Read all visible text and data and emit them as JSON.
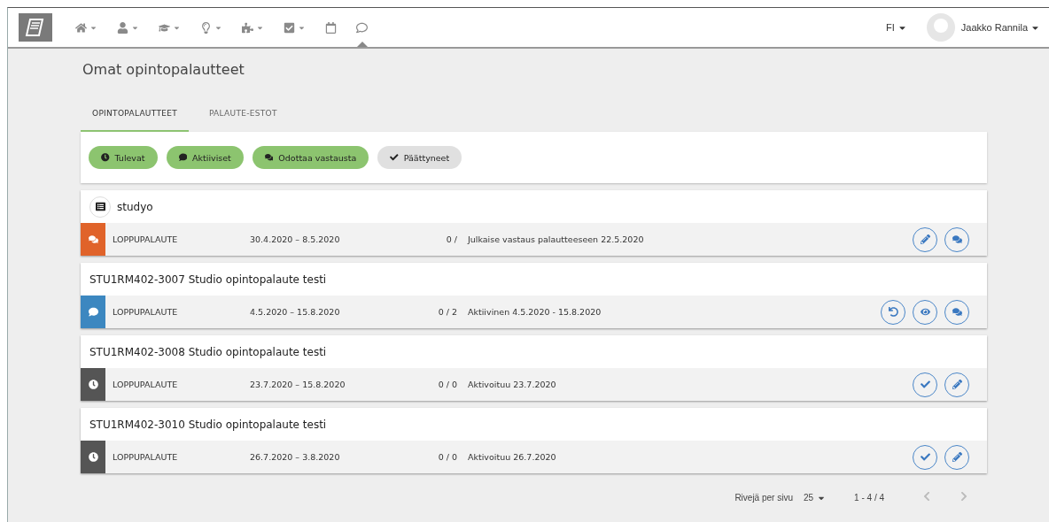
{
  "nav": {
    "items": [
      {
        "kind": "home",
        "has_menu": true,
        "selected": false
      },
      {
        "kind": "user",
        "has_menu": true,
        "selected": false
      },
      {
        "kind": "graduation",
        "has_menu": true,
        "selected": false
      },
      {
        "kind": "bulb",
        "has_menu": true,
        "selected": false
      },
      {
        "kind": "puzzle",
        "has_menu": true,
        "selected": false
      },
      {
        "kind": "checkbox",
        "has_menu": true,
        "selected": false
      },
      {
        "kind": "calendar",
        "has_menu": false,
        "selected": false
      },
      {
        "kind": "comment",
        "has_menu": false,
        "selected": true
      }
    ],
    "language": "FI",
    "user_name": "Jaakko Rannila"
  },
  "page_title": "Omat opintopalautteet",
  "tabs": [
    {
      "label": "OPINTOPALAUTTEET",
      "selected": true
    },
    {
      "label": "PALAUTE-ESTOT",
      "selected": false
    }
  ],
  "filters": [
    {
      "kind": "upcoming",
      "label": "Tulevat",
      "selected": true
    },
    {
      "kind": "active",
      "label": "Aktiiviset",
      "selected": true
    },
    {
      "kind": "awaiting",
      "label": "Odottaa vastausta",
      "selected": true
    },
    {
      "kind": "ended",
      "label": "Päättyneet",
      "selected": false
    }
  ],
  "cards": [
    {
      "title": "studyo",
      "has_icon": true,
      "row": {
        "kind": "awaiting",
        "type": "LOPPUPALAUTE",
        "dates": "30.4.2020 – 8.5.2020",
        "count": "0 /",
        "status": "Julkaise vastaus palautteeseen 22.5.2020"
      },
      "actions": [
        {
          "kind": "edit"
        },
        {
          "kind": "chat"
        }
      ]
    },
    {
      "title": "STU1RM402-3007 Studio opintopalaute testi",
      "has_icon": false,
      "row": {
        "kind": "active",
        "type": "LOPPUPALAUTE",
        "dates": "4.5.2020 – 15.8.2020",
        "count": "0 / 2",
        "status": "Aktiivinen 4.5.2020 - 15.8.2020"
      },
      "actions": [
        {
          "kind": "undo"
        },
        {
          "kind": "view"
        },
        {
          "kind": "chat"
        }
      ]
    },
    {
      "title": "STU1RM402-3008 Studio opintopalaute testi",
      "has_icon": false,
      "row": {
        "kind": "upcoming",
        "type": "LOPPUPALAUTE",
        "dates": "23.7.2020 – 15.8.2020",
        "count": "0 / 0",
        "status": "Aktivoituu 23.7.2020"
      },
      "actions": [
        {
          "kind": "approve"
        },
        {
          "kind": "edit"
        }
      ]
    },
    {
      "title": "STU1RM402-3010 Studio opintopalaute testi",
      "has_icon": false,
      "row": {
        "kind": "upcoming",
        "type": "LOPPUPALAUTE",
        "dates": "26.7.2020 – 3.8.2020",
        "count": "0 / 0",
        "status": "Aktivoituu 26.7.2020"
      },
      "actions": [
        {
          "kind": "approve"
        },
        {
          "kind": "edit"
        }
      ]
    }
  ],
  "pagination": {
    "rows_label": "Rivejä per sivu",
    "rows_value": "25",
    "range": "1 - 4 / 4"
  }
}
